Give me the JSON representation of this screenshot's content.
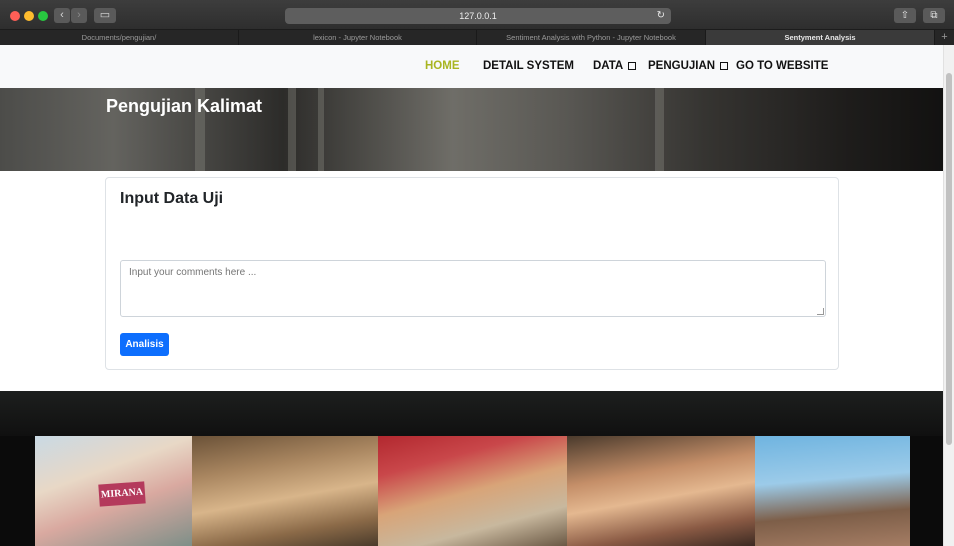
{
  "browser": {
    "url": "127.0.0.1",
    "tabs": [
      {
        "label": "Documents/pengujian/",
        "active": false
      },
      {
        "label": "lexicon - Jupyter Notebook",
        "active": false
      },
      {
        "label": "Sentiment Analysis with Python - Jupyter Notebook",
        "active": false
      },
      {
        "label": "Sentyment Analysis",
        "active": true
      }
    ],
    "icons": {
      "back": "‹",
      "forward": "›",
      "sidebar": "▭",
      "reload": "↻",
      "share": "⇧",
      "show_tabs": "⧉",
      "new_tab": "+"
    }
  },
  "nav": {
    "home": "HOME",
    "detail_system": "DETAIL SYSTEM",
    "data": "DATA",
    "pengujian": "PENGUJIAN",
    "go_to_website": "GO TO WEBSITE",
    "active_color": "#a8b520"
  },
  "hero": {
    "title": "Pengujian Kalimat"
  },
  "form": {
    "title": "Input Data Uji",
    "placeholder": "Input your comments here ...",
    "submit_label": "Analisis",
    "button_color": "#0d6efd"
  },
  "gallery": {
    "sign_text": "MIRANA"
  }
}
